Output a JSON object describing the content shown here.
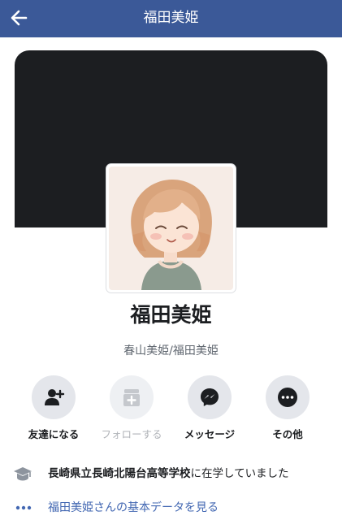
{
  "header": {
    "title": "福田美姫",
    "back_icon": "arrow-left-icon",
    "background_color": "#3b5998"
  },
  "profile": {
    "name": "福田美姫",
    "alternate_name": "春山美姫/福田美姫",
    "cover_color": "#1c1e21"
  },
  "actions": [
    {
      "label": "友達になる",
      "icon": "add-friend-icon",
      "enabled": true
    },
    {
      "label": "フォローする",
      "icon": "follow-icon",
      "enabled": false
    },
    {
      "label": "メッセージ",
      "icon": "messenger-icon",
      "enabled": true
    },
    {
      "label": "その他",
      "icon": "more-icon",
      "enabled": true
    }
  ],
  "info": {
    "school": "長崎県立長崎北陽台高等学校",
    "suffix": "に在学していました",
    "icon": "graduation-cap-icon"
  },
  "about_link": {
    "label": "福田美姫さんの基本データを見る",
    "icon": "ellipsis-icon",
    "color": "#4267b2"
  }
}
